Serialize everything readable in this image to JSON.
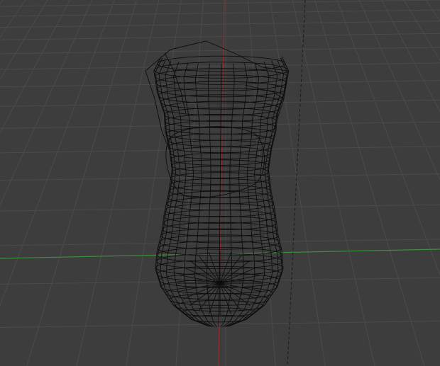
{
  "viewport": {
    "background_color": "#3d3d3d",
    "grid_color": "#4b4b4b",
    "x_axis_color": "#3e8f3e",
    "y_axis_color": "#8c2f2f",
    "wire_color": "#0d0d0d",
    "camera_line_color": "#1c1c1c"
  },
  "object": {
    "shape": "vase-wireframe",
    "display_mode": "wireframe"
  }
}
